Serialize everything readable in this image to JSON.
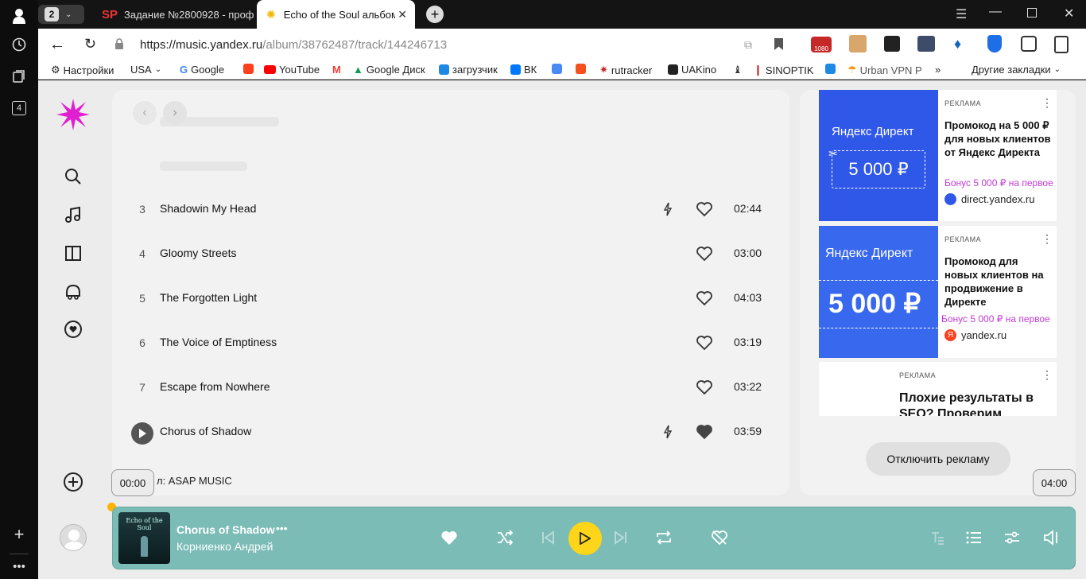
{
  "browser": {
    "tab_count": "2",
    "workspace_num": "4",
    "tabs": [
      {
        "label": "Задание №2800928 - проф"
      },
      {
        "label": "Echo of the Soul альбом"
      }
    ],
    "url_domain": "https://music.yandex.ru",
    "url_path": "/album/38762487/track/144246713",
    "bookmarks": [
      {
        "label": "Настройки"
      },
      {
        "label": "USA"
      },
      {
        "label": "Google"
      },
      {
        "label": ""
      },
      {
        "label": "YouTube"
      },
      {
        "label": ""
      },
      {
        "label": "Google Диск"
      },
      {
        "label": "загрузчик"
      },
      {
        "label": "ВК"
      },
      {
        "label": ""
      },
      {
        "label": ""
      },
      {
        "label": "rutracker"
      },
      {
        "label": "UAKino"
      },
      {
        "label": ""
      },
      {
        "label": "SINOPTIK"
      },
      {
        "label": ""
      },
      {
        "label": "Urban VPN P"
      }
    ],
    "more_bookmarks": "»",
    "other_bookmarks": "Другие закладки"
  },
  "tracks": [
    {
      "num": "3",
      "title": "Shadowin My Head",
      "duration": "02:44",
      "explicit_bolt": true,
      "liked": false
    },
    {
      "num": "4",
      "title": "Gloomy Streets",
      "duration": "03:00",
      "explicit_bolt": false,
      "liked": false
    },
    {
      "num": "5",
      "title": "The Forgotten Light",
      "duration": "04:03",
      "explicit_bolt": false,
      "liked": false
    },
    {
      "num": "6",
      "title": "The Voice of Emptiness",
      "duration": "03:19",
      "explicit_bolt": false,
      "liked": false
    },
    {
      "num": "7",
      "title": "Escape from Nowhere",
      "duration": "03:22",
      "explicit_bolt": false,
      "liked": false
    },
    {
      "num": "",
      "title": "Chorus of Shadow",
      "duration": "03:59",
      "explicit_bolt": true,
      "liked": true
    }
  ],
  "label_line": "л: ASAP MUSIC",
  "ads": [
    {
      "label": "РЕКЛАМА",
      "title": "Промокод на 5 000 ₽ для новых клиентов от Яндекс Директа",
      "bonus": "Бонус 5 000 ₽ на первое",
      "domain": "direct.yandex.ru",
      "img_brand": "Яндекс Директ",
      "img_amount": "5 000 ₽"
    },
    {
      "label": "РЕКЛАМА",
      "title": "Промокод для новых клиентов на продвижение в Директе",
      "bonus": "Бонус 5 000 ₽ на первое",
      "domain": "yandex.ru",
      "img_brand": "Яндекс Директ",
      "img_amount": "5 000 ₽"
    },
    {
      "label": "РЕКЛАМА",
      "title": "Плохие результаты в SEO? Проверим"
    }
  ],
  "disable_ads_label": "Отключить рекламу",
  "time_left": "00:00",
  "time_right": "04:00",
  "player": {
    "cover_text": "Echo of the Soul",
    "track_title": "Chorus of Shadow",
    "artist": "Корниенко Андрей",
    "progress": 0.0
  },
  "colors": {
    "player_bg": "#7bbcb6",
    "play_button": "#ffd51a",
    "logo": "#e01fd1",
    "ad_blue": "#2f57e8"
  }
}
